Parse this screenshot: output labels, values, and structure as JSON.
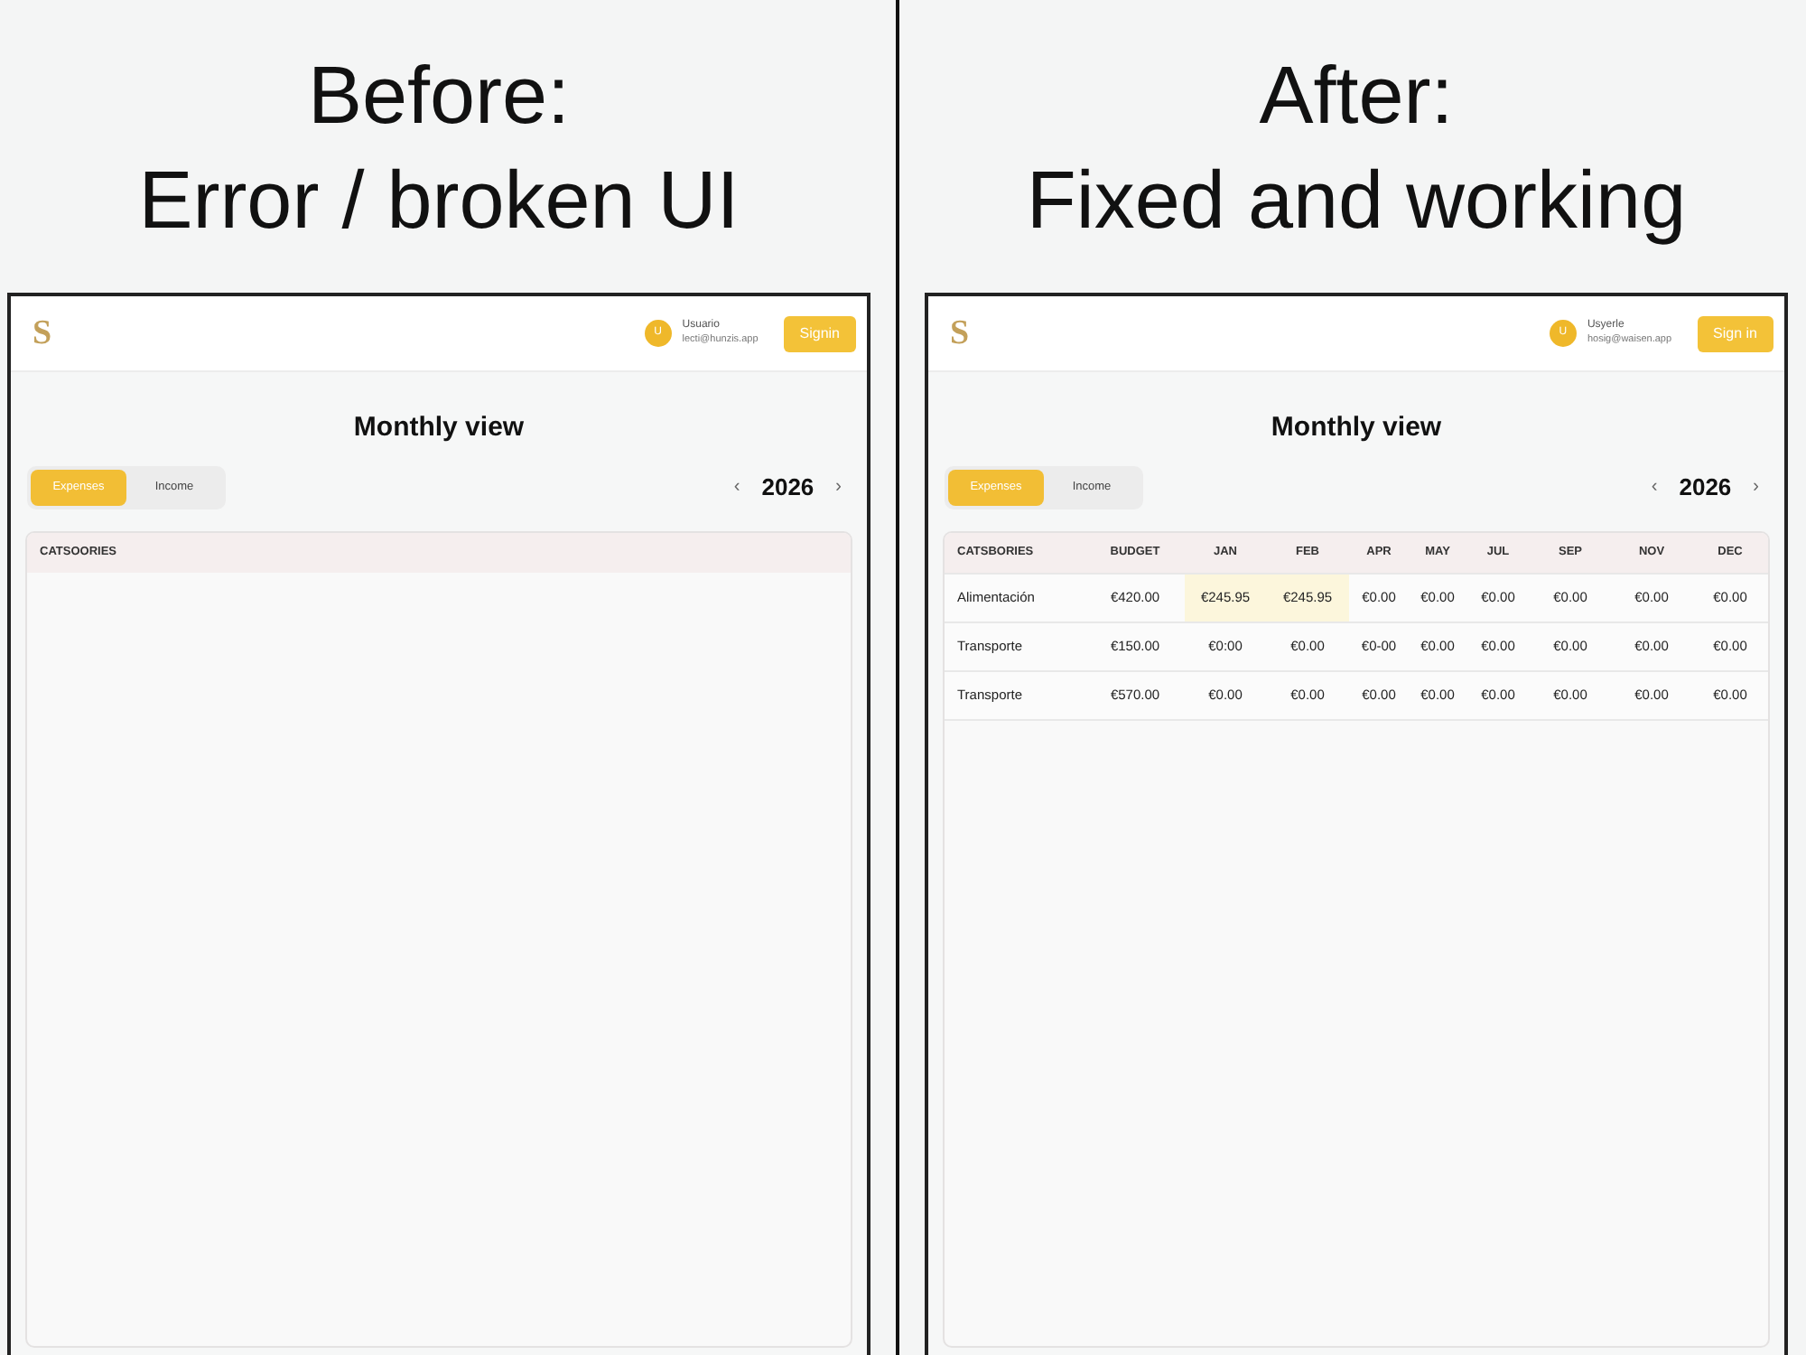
{
  "panels": [
    {
      "heading": "Before:",
      "subheading": "Error / broken UI",
      "header": {
        "logo": "S",
        "avatar_initial": "U",
        "user_name": "Usuario",
        "user_email": "lecti@hunzis.app",
        "sign_in": "Signin"
      },
      "title": "Monthly view",
      "tabs": [
        {
          "label": "Expenses",
          "selected": true
        },
        {
          "label": "Income",
          "selected": false
        }
      ],
      "year_nav": {
        "prev": "‹",
        "year": "2026",
        "next": "›"
      },
      "table": {
        "columns": [
          "CATSOORIES"
        ]
      }
    },
    {
      "heading": "After:",
      "subheading": "Fixed and working",
      "header": {
        "logo": "S",
        "avatar_initial": "U",
        "user_name": "Usyerle",
        "user_email": "hosig@waisen.app",
        "sign_in": "Sign in"
      },
      "title": "Monthly view",
      "tabs": [
        {
          "label": "Expenses",
          "selected": true
        },
        {
          "label": "Income",
          "selected": false
        }
      ],
      "year_nav": {
        "prev": "‹",
        "year": "2026",
        "next": "›"
      },
      "table": {
        "columns": [
          "CATSBORIES",
          "BUDGET",
          "JAN",
          "FEB",
          "APR",
          "MAY",
          "JUL",
          "SEP",
          "NOV",
          "DEC"
        ],
        "rows": [
          {
            "cells": [
              {
                "text": "Alimentación",
                "highlighted": false
              },
              {
                "text": "€420.00",
                "highlighted": false
              },
              {
                "text": "€245.95",
                "highlighted": true
              },
              {
                "text": "€245.95",
                "highlighted": true
              },
              {
                "text": "€0.00",
                "highlighted": false
              },
              {
                "text": "€0.00",
                "highlighted": false
              },
              {
                "text": "€0.00",
                "highlighted": false
              },
              {
                "text": "€0.00",
                "highlighted": false
              },
              {
                "text": "€0.00",
                "highlighted": false
              },
              {
                "text": "€0.00",
                "highlighted": false
              }
            ]
          },
          {
            "cells": [
              {
                "text": "Transporte",
                "highlighted": false
              },
              {
                "text": "€150.00",
                "highlighted": false
              },
              {
                "text": "€0:00",
                "highlighted": false
              },
              {
                "text": "€0.00",
                "highlighted": false
              },
              {
                "text": "€0-00",
                "highlighted": false
              },
              {
                "text": "€0.00",
                "highlighted": false
              },
              {
                "text": "€0.00",
                "highlighted": false
              },
              {
                "text": "€0.00",
                "highlighted": false
              },
              {
                "text": "€0.00",
                "highlighted": false
              },
              {
                "text": "€0.00",
                "highlighted": false
              }
            ]
          },
          {
            "cells": [
              {
                "text": "Transporte",
                "highlighted": false
              },
              {
                "text": "€570.00",
                "highlighted": false
              },
              {
                "text": "€0.00",
                "highlighted": false
              },
              {
                "text": "€0.00",
                "highlighted": false
              },
              {
                "text": "€0.00",
                "highlighted": false
              },
              {
                "text": "€0.00",
                "highlighted": false
              },
              {
                "text": "€0.00",
                "highlighted": false
              },
              {
                "text": "€0.00",
                "highlighted": false
              },
              {
                "text": "€0.00",
                "highlighted": false
              },
              {
                "text": "€0.00",
                "highlighted": false
              }
            ]
          }
        ]
      }
    }
  ]
}
